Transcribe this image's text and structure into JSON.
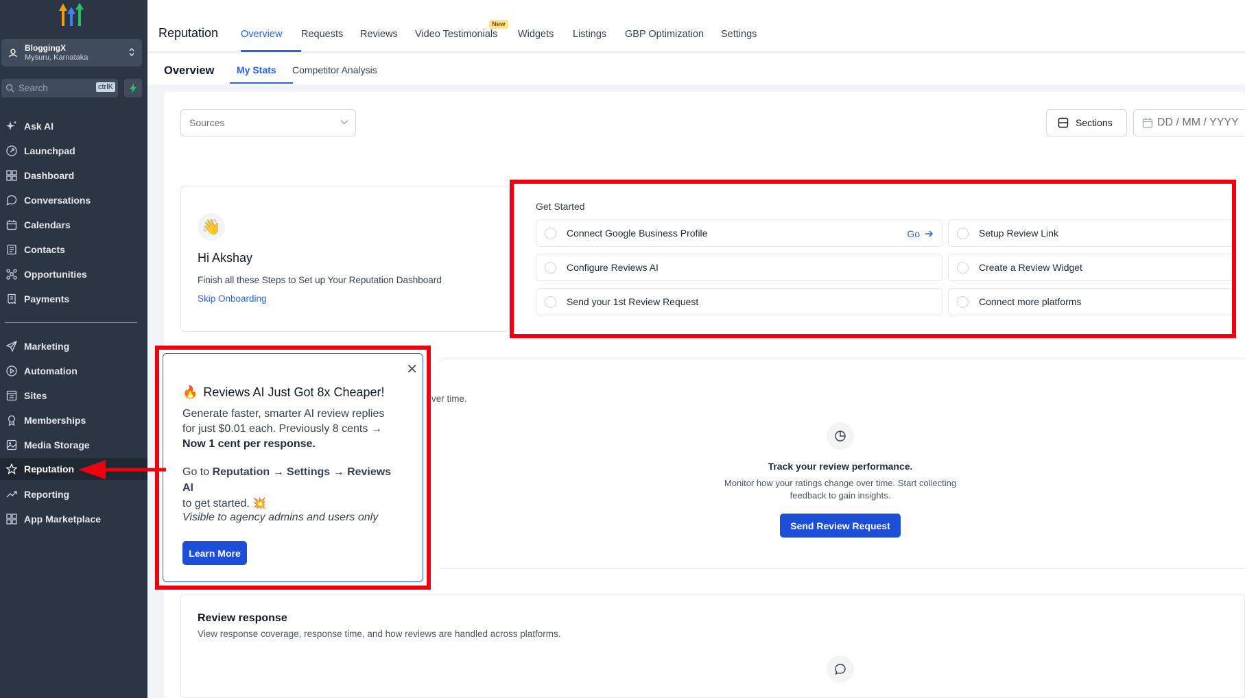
{
  "sidebar": {
    "account": {
      "name": "BloggingX",
      "location": "Mysuru, Karnataka"
    },
    "search": {
      "placeholder": "Search",
      "shortcut": "ctrlK"
    },
    "items": [
      {
        "label": "Ask AI",
        "icon": "sparkle-icon"
      },
      {
        "label": "Launchpad",
        "icon": "rocket-icon"
      },
      {
        "label": "Dashboard",
        "icon": "grid-icon"
      },
      {
        "label": "Conversations",
        "icon": "chat-icon"
      },
      {
        "label": "Calendars",
        "icon": "calendar-icon"
      },
      {
        "label": "Contacts",
        "icon": "contact-icon"
      },
      {
        "label": "Opportunities",
        "icon": "pipeline-icon"
      },
      {
        "label": "Payments",
        "icon": "receipt-icon"
      },
      {
        "label": "Marketing",
        "icon": "send-icon"
      },
      {
        "label": "Automation",
        "icon": "automation-icon"
      },
      {
        "label": "Sites",
        "icon": "sites-icon"
      },
      {
        "label": "Memberships",
        "icon": "membership-icon"
      },
      {
        "label": "Media Storage",
        "icon": "image-icon"
      },
      {
        "label": "Reputation",
        "icon": "star-icon"
      },
      {
        "label": "Reporting",
        "icon": "trend-icon"
      },
      {
        "label": "App Marketplace",
        "icon": "apps-icon"
      }
    ],
    "active": "Reputation"
  },
  "header": {
    "title": "Reputation",
    "tabs": [
      "Overview",
      "Requests",
      "Reviews",
      "Video Testimonials",
      "Widgets",
      "Listings",
      "GBP Optimization",
      "Settings"
    ],
    "active_tab": "Overview",
    "new_badge": "New"
  },
  "subheader": {
    "title": "Overview",
    "tabs": [
      "My Stats",
      "Competitor Analysis"
    ],
    "active_tab": "My Stats"
  },
  "filters": {
    "sources_placeholder": "Sources",
    "sections_label": "Sections",
    "date_placeholder": "DD / MM / YYYY"
  },
  "greeting": {
    "title": "Hi Akshay",
    "subtitle": "Finish all these Steps to Set up Your Reputation Dashboard",
    "skip": "Skip Onboarding",
    "emoji": "👋"
  },
  "get_started": {
    "title": "Get Started",
    "go_label": "Go",
    "tasks": [
      "Connect Google Business Profile",
      "Setup Review Link",
      "Configure Reviews AI",
      "Create a Review Widget",
      "Send your 1st Review Request",
      "Connect more platforms"
    ]
  },
  "performance": {
    "partial_text": "ver time.",
    "title": "Track your review performance.",
    "desc_line1": "Monitor how your ratings change over time. Start collecting",
    "desc_line2": "feedback to gain insights.",
    "button": "Send Review Request"
  },
  "response": {
    "title": "Review response",
    "desc": "View response coverage, response time, and how reviews are handled across platforms."
  },
  "popup": {
    "emoji": "🔥",
    "title": "Reviews AI Just Got 8x Cheaper!",
    "body_line1": "Generate faster, smarter AI review replies",
    "body_line2": "for just $0.01 each. Previously 8 cents →",
    "body_bold": "Now 1 cent per response.",
    "steps_prefix": "Go to ",
    "steps_path1": "Reputation",
    "steps_path2": "Settings",
    "steps_path3": "Reviews AI",
    "steps_suffix": "to get started.",
    "steps_emoji": "💥",
    "note": "Visible to agency admins and users only",
    "button": "Learn More"
  },
  "colors": {
    "accent": "#2563eb",
    "sidebar": "#2b3544",
    "highlight": "#f0000f"
  }
}
